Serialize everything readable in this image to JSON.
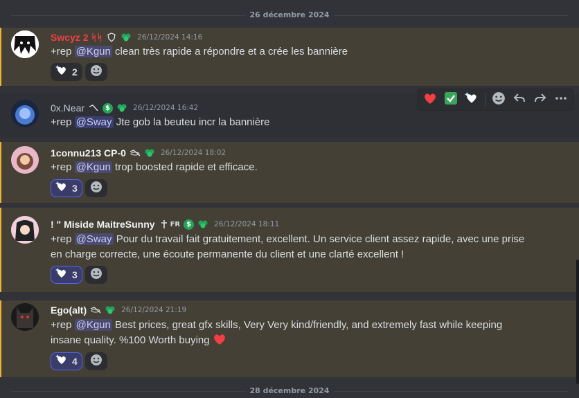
{
  "dividers": {
    "top": "26 décembre 2024",
    "bottom": "28 décembre 2024"
  },
  "messages": [
    {
      "author": "Swcyz 2 ᛋᛋ",
      "author_color": "#f23f43",
      "timestamp": "26/12/2024 14:16",
      "prefix": "+rep ",
      "mention": "@Kgun",
      "text": " clean très rapide a répondre et a crée les bannière",
      "reaction_count": "2"
    },
    {
      "author": "0x.Near",
      "author_color": "#c4c9ce",
      "timestamp": "26/12/2024 16:42",
      "prefix": "+rep ",
      "mention": "@Sway",
      "text": " Jte gob la beuteu incr la bannière"
    },
    {
      "author": "1connu213 CP-0",
      "author_color": "#f2f3f5",
      "timestamp": "26/12/2024 18:02",
      "prefix": "+rep ",
      "mention": "@Kgun",
      "text": "  trop boosted rapide et efficace.",
      "reaction_count": "3"
    },
    {
      "author": "! \" Miside MaitreSunny",
      "author_color": "#f2f3f5",
      "tag": "FR",
      "timestamp": "26/12/2024 18:11",
      "prefix": "+rep ",
      "mention": "@Sway",
      "text": " Pour du travail fait gratuitement, excellent. Un service client assez rapide, avec une prise en charge correcte, une écoute permanente du client et une clarté excellent !",
      "reaction_count": "3"
    },
    {
      "author": "Ego(alt)",
      "author_color": "#f2f3f5",
      "timestamp": "26/12/2024 21:19",
      "prefix": "+rep ",
      "mention": "@Kgun",
      "text": " Best prices, great gfx skills, Very Very kind/friendly, and extremely fast while keeping insane quality. %100 Worth buying ",
      "reaction_count": "4"
    }
  ],
  "colors": {
    "highlight_bg": "#444036",
    "highlight_bar": "#f0b232",
    "mention_bg": "#3c4270",
    "background": "#313338"
  },
  "icons": [
    "heart-emoji",
    "check-emoji",
    "heart-sparkle-emoji",
    "add-reaction-icon",
    "reply-icon",
    "forward-icon",
    "more-icon",
    "clover-badge-icon",
    "dollar-badge-icon",
    "satellite-icon"
  ]
}
